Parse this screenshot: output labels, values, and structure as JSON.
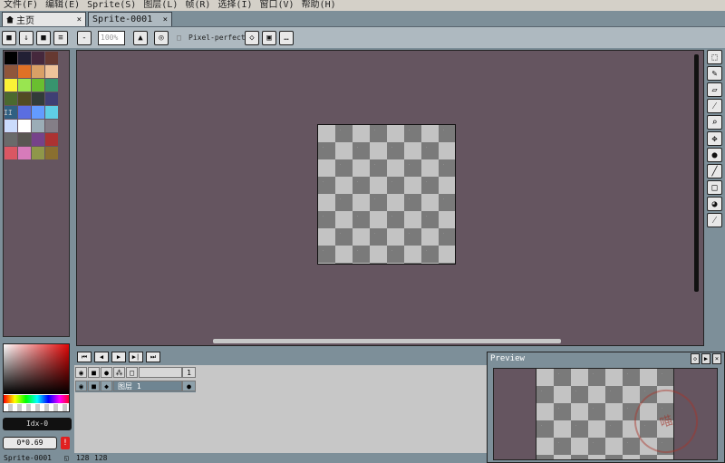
{
  "menu": [
    "文件(F)",
    "编辑(E)",
    "Sprite(S)",
    "图层(L)",
    "帧(R)",
    "选择(I)",
    "窗口(V)",
    "帮助(H)"
  ],
  "tabs": {
    "home": "主页",
    "sprite": "Sprite-0001",
    "close": "×"
  },
  "context_bar": {
    "zoom_placeholder": "100%",
    "pixel_perfect": "Pixel-perfect",
    "more": "…"
  },
  "palette": {
    "colors": [
      "#000000",
      "#222034",
      "#45283c",
      "#663931",
      "#8f563b",
      "#df7126",
      "#d9a066",
      "#eec39a",
      "#fbf236",
      "#99e550",
      "#6abe30",
      "#37946e",
      "#4b692f",
      "#524b24",
      "#323c39",
      "#3f3f74",
      "#306082",
      "#5b6ee1",
      "#639bff",
      "#5fcde4",
      "#cbdbfc",
      "#ffffff",
      "#9badb7",
      "#847e87",
      "#696a6a",
      "#595652",
      "#76428a",
      "#ac3232",
      "#d95763",
      "#d77bba",
      "#8f974a",
      "#8a6f30"
    ],
    "mark": "II"
  },
  "color_panel": {
    "index": "Idx-0",
    "alpha": "0*0.69",
    "warning": "!"
  },
  "timeline": {
    "buttons": [
      "⏮",
      "◀",
      "▶",
      "▶|",
      "⏭"
    ],
    "frame_number": "1",
    "layer_name": "图层 1"
  },
  "preview": {
    "title": "Preview",
    "watermark": "喵"
  },
  "status": {
    "sprite": "Sprite-0001",
    "width": "128",
    "height": "128"
  },
  "colors": {
    "canvas_bg": "#655560",
    "panel_bg": "#7d8f99",
    "checker_dark": "#7a7a7a",
    "checker_light": "#c3c3c3"
  }
}
